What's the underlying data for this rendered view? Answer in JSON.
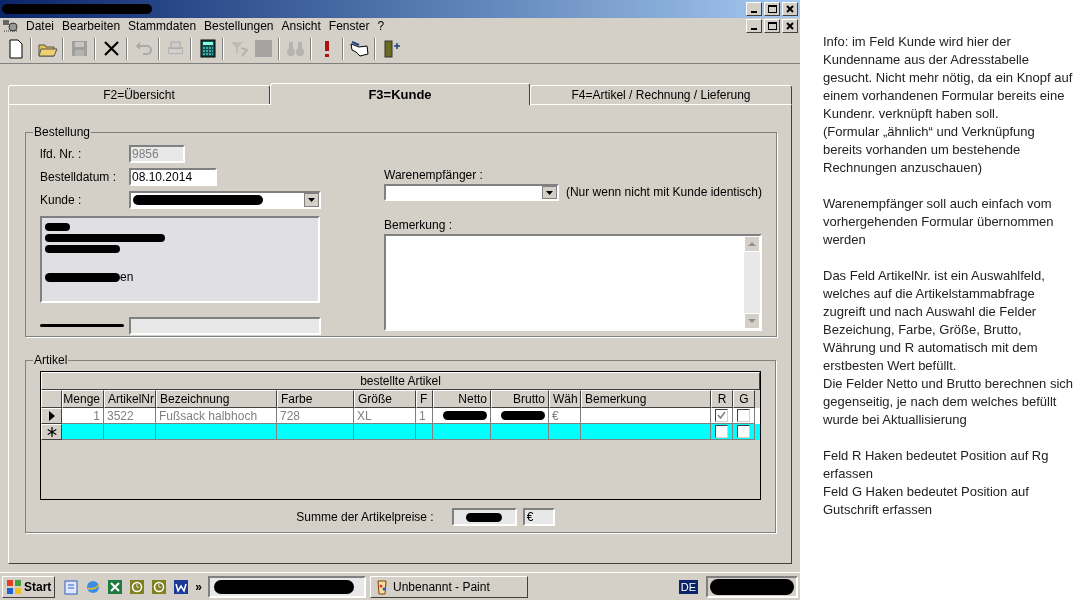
{
  "window": {
    "title_redacted": true
  },
  "menu": [
    "Datei",
    "Bearbeiten",
    "Stammdaten",
    "Bestellungen",
    "Ansicht",
    "Fenster",
    "?"
  ],
  "toolbar": [
    {
      "kind": "new",
      "disabled": false
    },
    {
      "kind": "sep"
    },
    {
      "kind": "open",
      "disabled": false
    },
    {
      "kind": "sep"
    },
    {
      "kind": "save",
      "disabled": true
    },
    {
      "kind": "sep"
    },
    {
      "kind": "delete",
      "disabled": false
    },
    {
      "kind": "sep"
    },
    {
      "kind": "undo",
      "disabled": true
    },
    {
      "kind": "sep"
    },
    {
      "kind": "print",
      "disabled": true
    },
    {
      "kind": "sep"
    },
    {
      "kind": "calculator",
      "disabled": false
    },
    {
      "kind": "sep"
    },
    {
      "kind": "filter",
      "disabled": true
    },
    {
      "kind": "stop",
      "disabled": true
    },
    {
      "kind": "sep"
    },
    {
      "kind": "binoculars",
      "disabled": true
    },
    {
      "kind": "sep"
    },
    {
      "kind": "exclamation",
      "disabled": false
    },
    {
      "kind": "sep"
    },
    {
      "kind": "hand",
      "disabled": false
    },
    {
      "kind": "sep"
    },
    {
      "kind": "exit",
      "disabled": false
    }
  ],
  "tabs": [
    {
      "label": "F2=Übersicht",
      "selected": false
    },
    {
      "label": "F3=Kunde",
      "selected": true
    },
    {
      "label": "F4=Artikel / Rechnung / Lieferung",
      "selected": false
    }
  ],
  "bestellung": {
    "title": "Bestellung",
    "lfd_nr": {
      "label": "lfd. Nr. :",
      "value": "9856",
      "disabled": true
    },
    "bestelldatum": {
      "label": "Bestelldatum :",
      "value": "08.10.2014"
    },
    "kunde": {
      "label": "Kunde :",
      "value_redacted": true
    },
    "address_fragment": "en",
    "krankenkasse": {
      "label_redacted": true,
      "disabled": true
    },
    "warenempfaenger": {
      "label": "Warenempfänger :",
      "hint": "(Nur wenn nicht mit Kunde identisch)"
    },
    "bemerkung": {
      "label": "Bemerkung :"
    }
  },
  "artikel": {
    "title": "Artikel",
    "grid_title": "bestellte Artikel",
    "columns": [
      "Menge",
      "ArtikelNr",
      "Bezeichnung",
      "Farbe",
      "Größe",
      "F",
      "Netto",
      "Brutto",
      "Wäh",
      "Bemerkung",
      "R",
      "G"
    ],
    "rows": [
      {
        "current": true,
        "new": false,
        "cells": [
          {
            "text": "1"
          },
          {
            "text": "3522"
          },
          {
            "text": "Fußsack halbhoch"
          },
          {
            "text": "728"
          },
          {
            "text": "XL"
          },
          {
            "text": "1"
          },
          {
            "redacted": true
          },
          {
            "redacted": true
          },
          {
            "text": "€"
          },
          {
            "text": ""
          },
          {
            "checked": true
          },
          {
            "checked": false
          }
        ]
      },
      {
        "current": false,
        "new": true,
        "cells": [
          {},
          {},
          {},
          {},
          {},
          {},
          {},
          {},
          {},
          {},
          {
            "checked": false
          },
          {
            "checked": false
          }
        ]
      }
    ],
    "sum_label": "Summe der Artikelpreise :",
    "sum_redacted": true,
    "sum_currency": "€"
  },
  "taskbar": {
    "start": "Start",
    "overflow": "»",
    "tasks": [
      {
        "redacted": true,
        "selected": true
      },
      {
        "label": "Unbenannt - Paint",
        "redacted": false,
        "selected": false
      }
    ],
    "language": "DE"
  },
  "notes": [
    "Info: im Feld Kunde wird hier der Kundenname aus der Adresstabelle gesucht. Nicht mehr nötig, da ein Knopf auf einem vorhandenen Formular bereits eine Kundenr. verknüpft haben soll.\n(Formular „ähnlich“ und Verknüpfung bereits vorhanden um bestehende Rechnungen anzuschauen)",
    "Warenempfänger soll auch einfach vom vorhergehenden Formular übernommen werden",
    "Das Feld ArtikelNr. ist ein Auswahlfeld, welches auf die Artikelstammabfrage zugreift und nach Auswahl die Felder Bezeichung, Farbe, Größe, Brutto, Währung und R automatisch mit dem erstbesten Wert befüllt.\nDie Felder Netto und Brutto berechnen sich gegenseitig, je nach dem welches befüllt wurde bei Aktuallisierung",
    "Feld R Haken bedeutet Position auf Rg erfassen\nFeld G Haken bedeutet Position auf Gutschrift erfassen"
  ]
}
